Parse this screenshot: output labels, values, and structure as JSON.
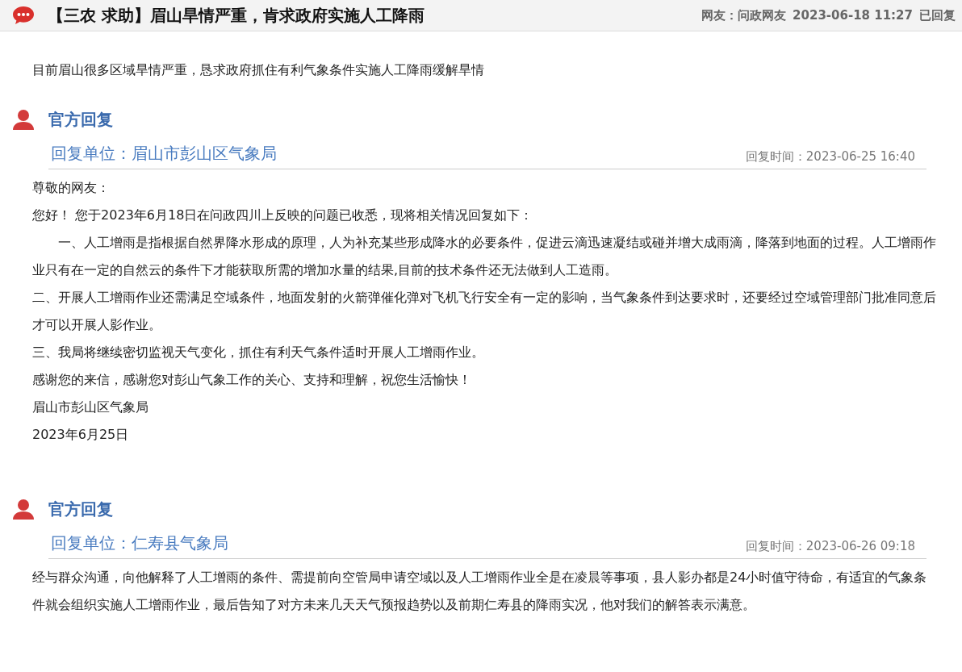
{
  "header": {
    "title": "【三农 求助】眉山旱情严重，肯求政府实施人工降雨",
    "author": "网友：问政网友",
    "date": "2023-06-18 11:27",
    "status": "已回复"
  },
  "question": "目前眉山很多区域旱情严重，恳求政府抓住有利气象条件实施人工降雨缓解旱情",
  "replies": [
    {
      "heading": "官方回复",
      "unit": "回复单位：眉山市彭山区气象局",
      "time": "回复时间：2023-06-25 16:40",
      "paragraphs": [
        {
          "kind": "plain",
          "text": "尊敬的网友："
        },
        {
          "kind": "plain",
          "text": "您好！ 您于2023年6月18日在问政四川上反映的问题已收悉，现将相关情况回复如下："
        },
        {
          "kind": "indented",
          "text": "一、人工增雨是指根据自然界降水形成的原理，人为补充某些形成降水的必要条件，促进云滴迅速凝结或碰并增大成雨滴，降落到地面的过程。人工增雨作业只有在一定的自然云的条件下才能获取所需的增加水量的结果,目前的技术条件还无法做到人工造雨。"
        },
        {
          "kind": "plain",
          "text": "二、开展人工增雨作业还需满足空域条件，地面发射的火箭弹催化弹对飞机飞行安全有一定的影响，当气象条件到达要求时，还要经过空域管理部门批准同意后才可以开展人影作业。"
        },
        {
          "kind": "plain",
          "text": "三、我局将继续密切监视天气变化，抓住有利天气条件适时开展人工增雨作业。"
        },
        {
          "kind": "plain",
          "text": "感谢您的来信，感谢您对彭山气象工作的关心、支持和理解，祝您生活愉快！"
        },
        {
          "kind": "plain",
          "text": "眉山市彭山区气象局"
        },
        {
          "kind": "plain",
          "text": "2023年6月25日"
        }
      ]
    },
    {
      "heading": "官方回复",
      "unit": "回复单位：仁寿县气象局",
      "time": "回复时间：2023-06-26 09:18",
      "paragraphs": [
        {
          "kind": "plain",
          "text": "经与群众沟通，向他解释了人工增雨的条件、需提前向空管局申请空域以及人工增雨作业全是在凌晨等事项，县人影办都是24小时值守待命，有适宜的气象条件就会组织实施人工增雨作业，最后告知了对方未来几天天气预报趋势以及前期仁寿县的降雨实况，他对我们的解答表示满意。"
        }
      ]
    }
  ]
}
